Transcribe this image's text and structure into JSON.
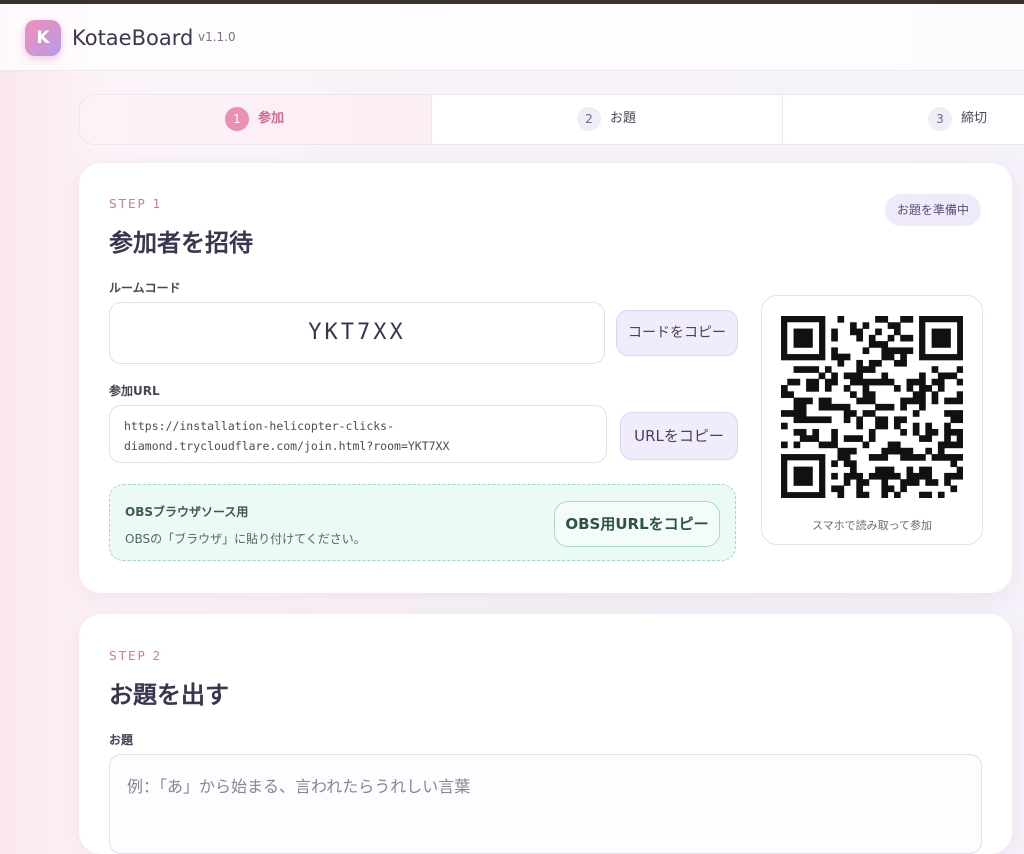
{
  "app": {
    "logo_letter": "K",
    "name": "KotaeBoard",
    "version": "v1.1.0"
  },
  "steps": [
    {
      "num": "1",
      "label": "参加"
    },
    {
      "num": "2",
      "label": "お題"
    },
    {
      "num": "3",
      "label": "締切"
    }
  ],
  "step1": {
    "eyebrow": "STEP 1",
    "title": "参加者を招待",
    "status_badge": "お題を準備中",
    "room_code_label": "ルームコード",
    "room_code": "YKT7XX",
    "copy_code_button": "コードをコピー",
    "join_url_label": "参加URL",
    "join_url": "https://installation-helicopter-clicks-\ndiamond.trycloudflare.com/join.html?room=YKT7XX",
    "copy_url_button": "URLをコピー",
    "obs_title": "OBSブラウザソース用",
    "obs_hint": "OBSの「ブラウザ」に貼り付けてください。",
    "obs_copy_button": "OBS用URLをコピー",
    "qr_caption": "スマホで読み取って参加"
  },
  "step2": {
    "eyebrow": "STEP 2",
    "title": "お題を出す",
    "topic_label": "お題",
    "topic_placeholder": "例：「あ」から始まる、言われたらうれしい言葉"
  }
}
